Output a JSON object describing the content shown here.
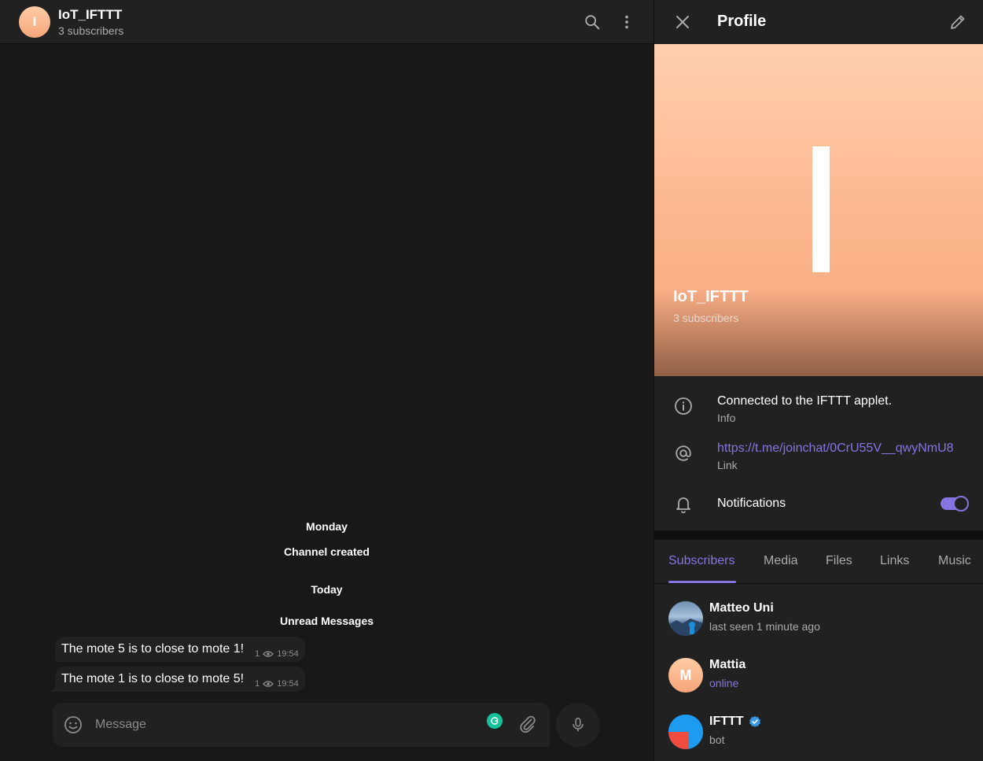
{
  "chat": {
    "avatar_letter": "I",
    "title": "IoT_IFTTT",
    "subtitle": "3 subscribers",
    "service_messages": [
      "Monday",
      "Channel created",
      "Today",
      "Unread Messages"
    ],
    "messages": [
      {
        "text": "The mote 5 is to close to mote 1!",
        "views": "1",
        "time": "19:54"
      },
      {
        "text": "The mote 1 is to close to mote 5!",
        "views": "1",
        "time": "19:54"
      }
    ],
    "composer": {
      "placeholder": "Message"
    }
  },
  "profile": {
    "header_title": "Profile",
    "name": "IoT_IFTTT",
    "subtitle": "3 subscribers",
    "info": {
      "text": "Connected to the IFTTT applet.",
      "label": "Info"
    },
    "link": {
      "text": "https://t.me/joinchat/0CrU55V__qwyNmU8",
      "label": "Link"
    },
    "notifications": {
      "label": "Notifications",
      "enabled": true
    },
    "tabs": [
      "Subscribers",
      "Media",
      "Files",
      "Links",
      "Music"
    ],
    "active_tab": "Subscribers",
    "members": [
      {
        "name": "Matteo Uni",
        "status": "last seen 1 minute ago",
        "avatar": "photo"
      },
      {
        "name": "Mattia",
        "status": "online",
        "avatar_letter": "M"
      },
      {
        "name": "IFTTT",
        "status": "bot",
        "verified": true
      }
    ]
  },
  "colors": {
    "accent": "#8774e1",
    "background": "#181818",
    "panel": "#212121",
    "avatar_peach": "#f6a47a",
    "verified_blue": "#3a9ae9",
    "grammarly_green": "#15c39a"
  }
}
